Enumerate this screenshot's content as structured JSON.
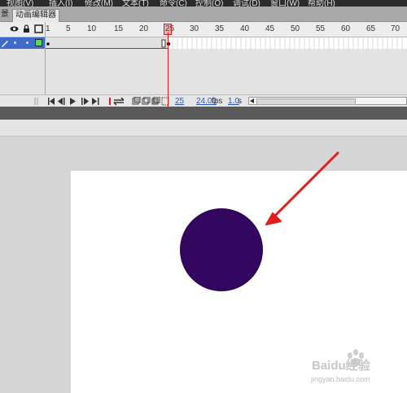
{
  "menu": {
    "items": [
      "视图(V)",
      "插入(I)",
      "修改(M)",
      "文本(T)",
      "命令(C)",
      "控制(O)",
      "调试(D)",
      "窗口(W)",
      "帮助(H)"
    ]
  },
  "tabs": [
    "景",
    "动画编辑器"
  ],
  "timeline": {
    "ruler_numbers": [
      "1",
      "5",
      "10",
      "15",
      "20",
      "25",
      "30",
      "35",
      "40",
      "45",
      "50",
      "55",
      "60",
      "65",
      "70"
    ],
    "current_frame": "25",
    "frame_rate": "24.00",
    "fps_unit": "fps",
    "elapsed_time": "1.0",
    "time_unit": "s"
  },
  "stage": {
    "circle_color": "#330660",
    "arrow_color": "#e02020"
  },
  "watermark": {
    "brand": "Baidu经验",
    "url": "jingyan.baidu.com"
  },
  "colors": {
    "playhead": "#d62020",
    "selection": "#3d6bc8",
    "link_blue": "#2a58b8"
  }
}
